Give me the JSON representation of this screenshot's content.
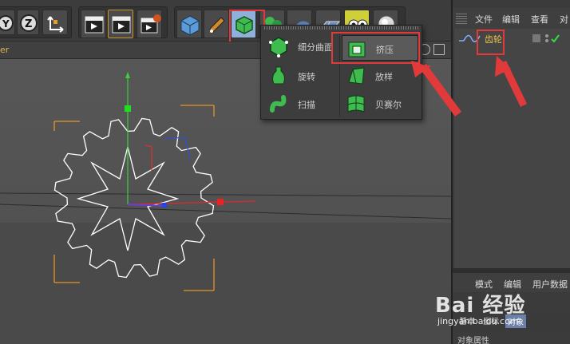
{
  "menu": {
    "items": [
      {
        "label": "细分曲面",
        "icon": "subdivision-surface-icon"
      },
      {
        "label": "挤压",
        "icon": "extrude-icon"
      },
      {
        "label": "旋转",
        "icon": "lathe-icon"
      },
      {
        "label": "放样",
        "icon": "loft-icon"
      },
      {
        "label": "扫描",
        "icon": "sweep-icon"
      },
      {
        "label": "贝赛尔",
        "icon": "bezier-icon"
      }
    ]
  },
  "viewport": {
    "label": "er"
  },
  "object_manager": {
    "menus": [
      "文件",
      "编辑",
      "查看",
      "对"
    ],
    "object_name": "齿轮"
  },
  "attribute_manager": {
    "menus": [
      "模式",
      "编辑",
      "用户数据"
    ],
    "tabs": [
      "基本",
      "坐标",
      "对象"
    ],
    "section_title": "对象属性"
  },
  "watermark": {
    "brand": "Bai 经验",
    "url": "jingyan.baidu.com"
  },
  "colors": {
    "highlight": "#e23a3a",
    "object_name": "#f0c24a",
    "accent_tab": "#6b7fa8"
  }
}
